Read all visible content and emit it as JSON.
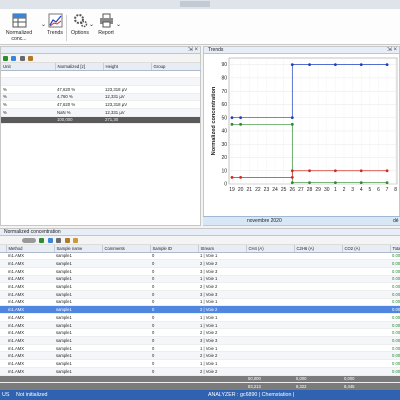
{
  "ribbon": {
    "normalized_label": "Normalized conc...",
    "trends_label": "Trends",
    "options_label": "Options",
    "report_label": "Report"
  },
  "top_left": {
    "columns": [
      "Unit",
      "Normalized [z]",
      "Height",
      "Group"
    ],
    "rows": [
      {
        "unit": "%",
        "normalized": "47,620 %",
        "height": "123,318 µV",
        "group": ""
      },
      {
        "unit": "%",
        "normalized": "4,760 %",
        "height": "12,331 µV",
        "group": ""
      },
      {
        "unit": "%",
        "normalized": "47,620 %",
        "height": "123,318 µV",
        "group": ""
      },
      {
        "unit": "%",
        "normalized": "NaN %",
        "height": "12,331 µV",
        "group": ""
      },
      {
        "unit": "",
        "normalized": "100,000",
        "height": "271,30",
        "group": ""
      }
    ]
  },
  "trends": {
    "title": "Trends"
  },
  "chart_data": {
    "type": "line",
    "title": "",
    "ylabel": "Normalized concentration",
    "xlabel": "",
    "ylim": [
      0,
      95
    ],
    "y_ticks": [
      "0",
      "10",
      "20",
      "30",
      "40",
      "50",
      "60",
      "70",
      "80",
      "90"
    ],
    "x_ticks": [
      "19",
      "20",
      "21",
      "22",
      "23",
      "24",
      "25",
      "26",
      "27",
      "28",
      "29",
      "30",
      "1",
      "2",
      "3",
      "4",
      "5",
      "6",
      "7",
      "8"
    ],
    "month_labels": [
      "novembre 2020",
      "dé"
    ],
    "series": [
      {
        "color": "#1f3fbf",
        "points": [
          [
            19,
            50
          ],
          [
            20,
            50
          ],
          [
            26,
            50
          ],
          [
            26,
            90
          ],
          [
            28,
            90
          ],
          [
            1,
            90
          ],
          [
            4,
            90
          ],
          [
            7,
            90
          ]
        ]
      },
      {
        "color": "#2e8b2e",
        "points": [
          [
            19,
            45
          ],
          [
            20,
            45
          ],
          [
            26,
            45
          ],
          [
            26,
            1
          ],
          [
            28,
            1
          ],
          [
            1,
            1
          ],
          [
            4,
            1
          ],
          [
            7,
            1
          ]
        ]
      },
      {
        "color": "#d02a1e",
        "points": [
          [
            19,
            5
          ],
          [
            20,
            5
          ],
          [
            26,
            5
          ],
          [
            26,
            10
          ],
          [
            28,
            10
          ],
          [
            1,
            10
          ],
          [
            4,
            10
          ],
          [
            7,
            10
          ]
        ]
      }
    ]
  },
  "bottom": {
    "title": "Normalized concentration",
    "columns": [
      "Method",
      "Sample name",
      "Comments",
      "Sample ID",
      "Stream",
      "CH4 (A)",
      "C2H6 (A)",
      "CO2 (A)",
      "Tota"
    ],
    "rows": [
      {
        "method": "m1.AMX",
        "sample": "sample1",
        "comments": "",
        "id": "0",
        "stream": "1 | Voie 1",
        "ch4": "",
        "c2h6": "",
        "co2": "",
        "total": "0.00"
      },
      {
        "method": "m1.AMX",
        "sample": "sample1",
        "comments": "",
        "id": "0",
        "stream": "2 | Voie 2",
        "ch4": "",
        "c2h6": "",
        "co2": "",
        "total": "0.00"
      },
      {
        "method": "m1.AMX",
        "sample": "sample1",
        "comments": "",
        "id": "0",
        "stream": "3 | Voie 3",
        "ch4": "",
        "c2h6": "",
        "co2": "",
        "total": "0.00"
      },
      {
        "method": "m1.AMX",
        "sample": "sample1",
        "comments": "",
        "id": "0",
        "stream": "1 | Voie 1",
        "ch4": "",
        "c2h6": "",
        "co2": "",
        "total": "0.00"
      },
      {
        "method": "m1.AMX",
        "sample": "sample1",
        "comments": "",
        "id": "0",
        "stream": "2 | Voie 2",
        "ch4": "",
        "c2h6": "",
        "co2": "",
        "total": "0.00"
      },
      {
        "method": "m1.AMX",
        "sample": "sample1",
        "comments": "",
        "id": "0",
        "stream": "3 | Voie 3",
        "ch4": "",
        "c2h6": "",
        "co2": "",
        "total": "0.00"
      },
      {
        "method": "m1.AMX",
        "sample": "sample1",
        "comments": "",
        "id": "0",
        "stream": "1 | Voie 1",
        "ch4": "",
        "c2h6": "",
        "co2": "",
        "total": "0.00"
      },
      {
        "method": "m1.AMX",
        "sample": "sample1",
        "comments": "",
        "id": "0",
        "stream": "2 | Voie 2",
        "ch4": "",
        "c2h6": "",
        "co2": "",
        "total": "0.00"
      },
      {
        "method": "m1.AMX",
        "sample": "sample1",
        "comments": "",
        "id": "0",
        "stream": "1 | Voie 1",
        "ch4": "",
        "c2h6": "",
        "co2": "",
        "total": "0.00"
      },
      {
        "method": "m1.AMX",
        "sample": "sample1",
        "comments": "",
        "id": "0",
        "stream": "1 | Voie 1",
        "ch4": "",
        "c2h6": "",
        "co2": "",
        "total": "0.00"
      },
      {
        "method": "m1.AMX",
        "sample": "sample1",
        "comments": "",
        "id": "0",
        "stream": "2 | Voie 2",
        "ch4": "",
        "c2h6": "",
        "co2": "",
        "total": "0.00"
      },
      {
        "method": "m1.AMX",
        "sample": "sample1",
        "comments": "",
        "id": "0",
        "stream": "3 | Voie 3",
        "ch4": "",
        "c2h6": "",
        "co2": "",
        "total": "0.00"
      },
      {
        "method": "m1.AMX",
        "sample": "sample1",
        "comments": "",
        "id": "0",
        "stream": "1 | Voie 1",
        "ch4": "",
        "c2h6": "",
        "co2": "",
        "total": "0.00"
      },
      {
        "method": "m1.AMX",
        "sample": "sample1",
        "comments": "",
        "id": "0",
        "stream": "2 | Voie 2",
        "ch4": "",
        "c2h6": "",
        "co2": "",
        "total": "0.00"
      },
      {
        "method": "m1.AMX",
        "sample": "sample1",
        "comments": "",
        "id": "0",
        "stream": "1 | Voie 1",
        "ch4": "",
        "c2h6": "",
        "co2": "",
        "total": "0.00"
      },
      {
        "method": "m1.AMX",
        "sample": "sample1",
        "comments": "",
        "id": "0",
        "stream": "2 | Voie 2",
        "ch4": "",
        "c2h6": "",
        "co2": "",
        "total": "0.00"
      }
    ],
    "selected_row": 7,
    "summary": [
      {
        "ch4": "50,000",
        "c2h6": "5,000",
        "co2": "0,000"
      },
      {
        "ch4": "83,213",
        "c2h6": "8,322",
        "co2": "8,445"
      },
      {
        "ch4": "90,909",
        "c2h6": "9,091",
        "co2": "45,000"
      },
      {
        "ch4": "19,309",
        "c2h6": "19,309",
        "co2": "209,701"
      }
    ]
  },
  "status": {
    "left": "US",
    "state": "Not initialized",
    "center": "ANALYZER : gc6890 | Chemstation |"
  }
}
